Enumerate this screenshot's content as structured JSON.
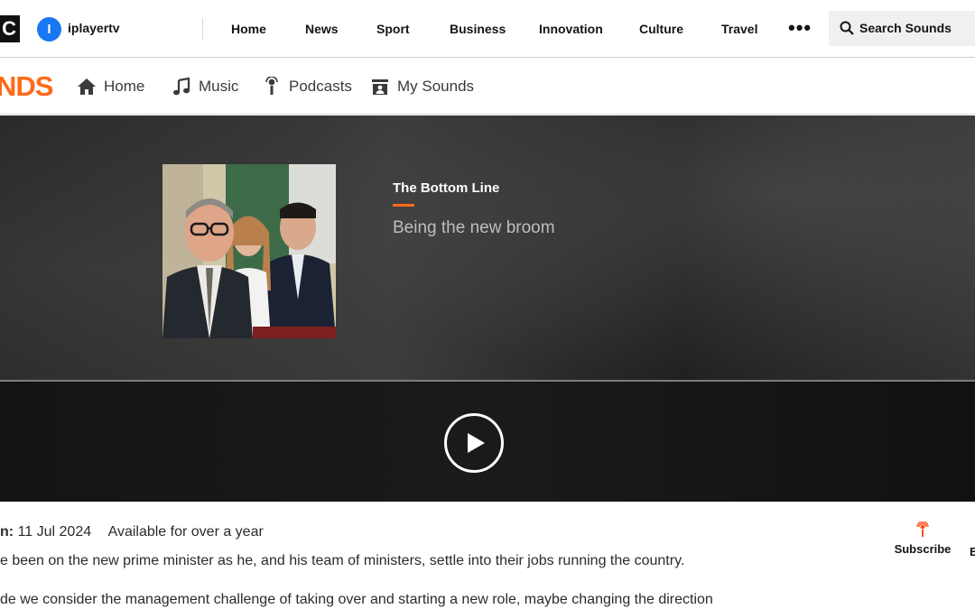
{
  "topbar": {
    "bbc_fragment": "C",
    "iplayer_label": "iplayertv",
    "nav": [
      "Home",
      "News",
      "Sport",
      "Business",
      "Innovation",
      "Culture",
      "Travel"
    ],
    "more": "•••",
    "search_placeholder": "Search Sounds"
  },
  "sounds_nav": {
    "logo_fragment": "NDS",
    "items": [
      {
        "label": "Home",
        "icon": "home-icon"
      },
      {
        "label": "Music",
        "icon": "music-note-icon"
      },
      {
        "label": "Podcasts",
        "icon": "podcast-mic-icon"
      },
      {
        "label": "My Sounds",
        "icon": "my-sounds-icon"
      }
    ]
  },
  "hero": {
    "show_title": "The Bottom Line",
    "episode_title": "Being the new broom",
    "accent": "#ff6a1a"
  },
  "details": {
    "release_label": "n:",
    "release_date": "11 Jul 2024",
    "availability": "Available for over a year",
    "description_line1": "e been on the new prime minister as he, and his team of ministers, settle into their jobs running the country.",
    "description_line2": "de we consider the management challenge of taking over and starting a new role, maybe changing the direction",
    "subscribe_label": "Subscribe",
    "edge_fragment": "E"
  },
  "colors": {
    "brand_orange": "#ff6a1a",
    "iplayer_blue": "#1877f2"
  }
}
